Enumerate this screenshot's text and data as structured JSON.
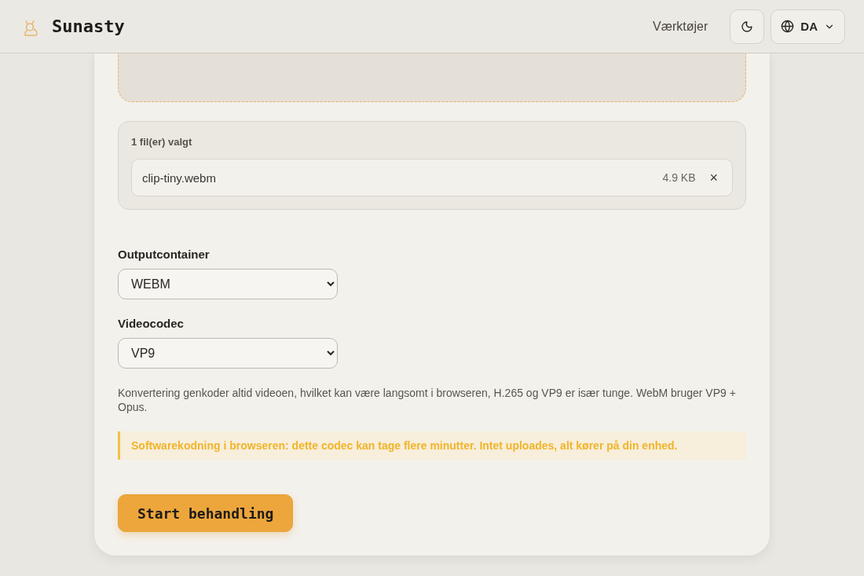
{
  "header": {
    "brand": "Sunasty",
    "nav_link": "Værktøjer",
    "language": "DA"
  },
  "files": {
    "count_label": "1 fil(er) valgt",
    "items": [
      {
        "name": "clip-tiny.webm",
        "size": "4.9 KB",
        "remove": "×"
      }
    ]
  },
  "fields": [
    {
      "label": "Outputcontainer",
      "value": "WEBM"
    },
    {
      "label": "Videocodec",
      "value": "VP9"
    }
  ],
  "note": "Konvertering genkoder altid videoen, hvilket kan være langsomt i browseren, H.265 og VP9 er især tunge. WebM bruger VP9 + Opus.",
  "warning": "Softwarekodning i browseren: dette codec kan tage flere minutter. Intet uploades, alt kører på din enhed.",
  "start_button": "Start behandling"
}
